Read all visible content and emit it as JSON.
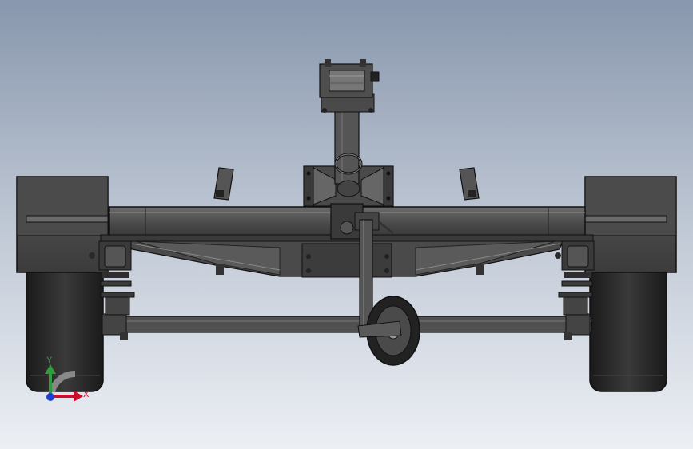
{
  "colors": {
    "background_top": "#8a98ae",
    "background_bottom": "#e9edf3",
    "body_dark": "#3c3c3c",
    "body_mid": "#5f5f5f",
    "body_light": "#8a8a8a",
    "edge": "#1a1a1a",
    "tire": "#222222",
    "axis_x": "#c8102e",
    "axis_y": "#2e9d3a",
    "axis_z": "#1f3fd1"
  },
  "triad": {
    "x_label": "X",
    "y_label": "Y"
  }
}
